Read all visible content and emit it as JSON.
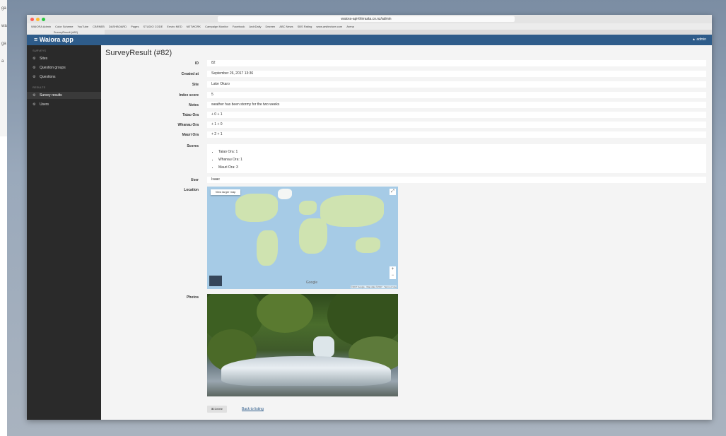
{
  "left_strip": {
    "items": [
      "ga",
      "wa",
      "ga",
      "a"
    ]
  },
  "browser": {
    "url": "waiora-api-thirrasta.co.nz/admin",
    "bookmarks": [
      "WAIORA Admin",
      "Color Scheme",
      "YouTube",
      "CBRNEB",
      "DASHBOARD",
      "Pages",
      "STUDIO CODE",
      "Enviro MED",
      "NETWORK",
      "Campaign Monitor",
      "Facebook",
      "ArchDaily",
      "Dezeen",
      "ABC News",
      "SBS Rating",
      "www.arsitecture.com",
      "Arena"
    ],
    "tab_label": "SurveyResult (#82)"
  },
  "app": {
    "title": "≡  Waiora app",
    "user": "▲ admin"
  },
  "sidebar": {
    "head1": "SURVEYS",
    "items": [
      {
        "icon": "⚙",
        "label": "Sites"
      },
      {
        "icon": "⚙",
        "label": "Question groups"
      },
      {
        "icon": "⚙",
        "label": "Questions"
      }
    ],
    "head2": "RESULTS",
    "items2": [
      {
        "icon": "⚙",
        "label": "Survey results"
      },
      {
        "icon": "⚙",
        "label": "Users"
      }
    ]
  },
  "page": {
    "title": "SurveyResult (#82)",
    "fields": {
      "id_label": "ID",
      "id": "82",
      "created_label": "Created at",
      "created": "September 26, 2017 13:36",
      "site_label": "Site",
      "site": "Lake Okaro",
      "index_label": "Index score",
      "index": "5",
      "notes_label": "Notes",
      "notes": "weather has been stormy for the two weeks",
      "taiao_label": "Taiao Ora",
      "taiao": "+ 0   + 1",
      "whanau_label": "Whanau Ora",
      "whanau": "+ 1   + 0",
      "mauri_label": "Mauri Ora",
      "mauri": "+ 2   + 1",
      "scores_label": "Scores",
      "scores": [
        "Taiao Ora: 1",
        "Whanau Ora: 1",
        "Mauri Ora: 3"
      ],
      "user_label": "User",
      "user": "Isaac",
      "location_label": "Location",
      "photos_label": "Photos"
    },
    "map": {
      "larger_map": "View larger map",
      "google": "Google",
      "terms": "©2017 Google · Map data ©2017 · Terms of Use",
      "zoom_in": "+",
      "zoom_out": "−"
    },
    "delete_label": "⊠ Delete",
    "back_label": "Back to listing"
  }
}
